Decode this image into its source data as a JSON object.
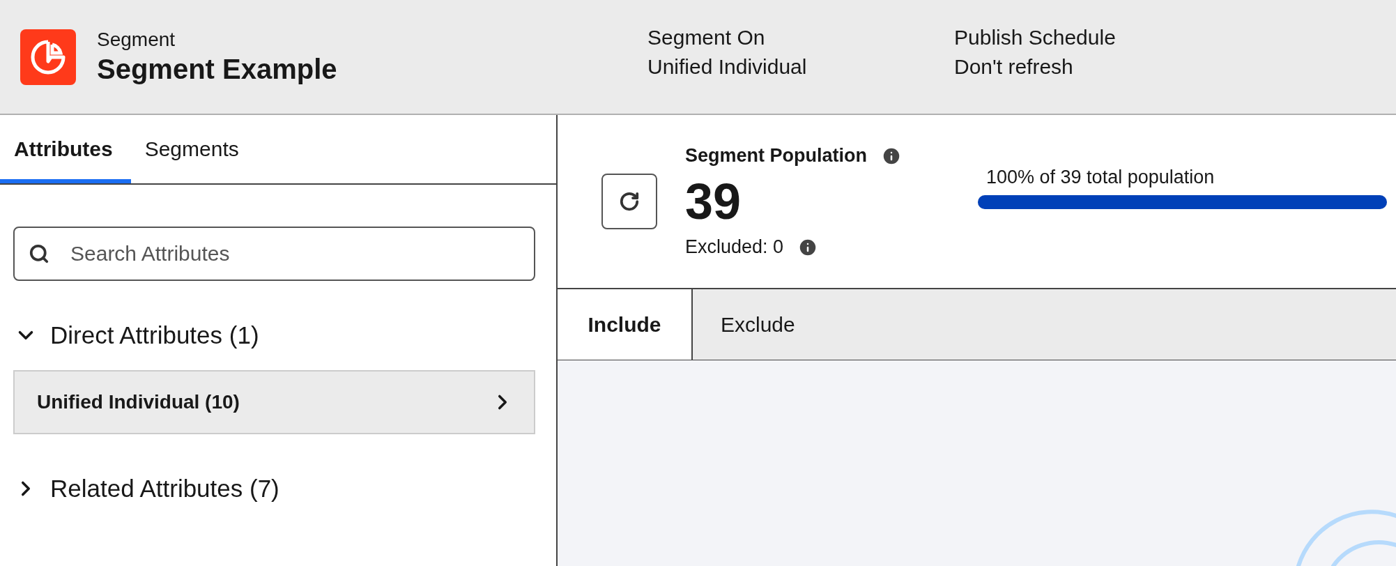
{
  "header": {
    "app_name": "Segment",
    "title": "Segment Example",
    "fields": [
      {
        "label": "Segment On",
        "value": "Unified Individual"
      },
      {
        "label": "Publish Schedule",
        "value": "Don't refresh"
      }
    ]
  },
  "sidebar": {
    "tabs": [
      {
        "label": "Attributes",
        "selected": true
      },
      {
        "label": "Segments",
        "selected": false
      }
    ],
    "search": {
      "placeholder": "Search Attributes"
    },
    "sections": [
      {
        "title": "Direct Attributes (1)",
        "expanded": true,
        "items": [
          {
            "label": "Unified Individual (10)"
          }
        ]
      },
      {
        "title": "Related Attributes (7)",
        "expanded": false
      }
    ]
  },
  "population": {
    "title": "Segment Population",
    "count": "39",
    "excluded": "Excluded: 0",
    "progress_label": "100% of 39 total population",
    "level": 1
  },
  "rule_tabs": [
    {
      "label": "Include",
      "selected": true
    },
    {
      "label": "Exclude",
      "selected": false
    }
  ]
}
